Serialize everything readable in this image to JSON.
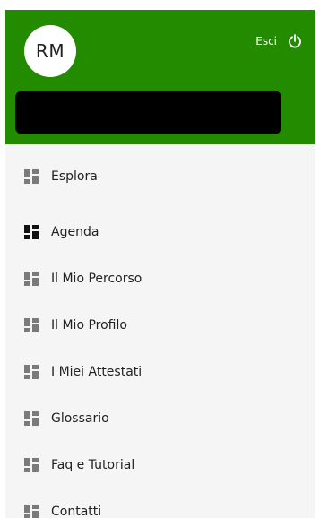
{
  "header": {
    "avatar_initials": "RM",
    "logout_label": "Esci",
    "logout_icon": "power-icon",
    "background_color": "#228b00"
  },
  "menu": {
    "items": [
      {
        "label": "Esplora",
        "icon": "dashboard-icon",
        "active": false
      },
      {
        "label": "Agenda",
        "icon": "dashboard-icon",
        "active": true
      },
      {
        "label": "Il Mio Percorso",
        "icon": "dashboard-icon",
        "active": false
      },
      {
        "label": "Il Mio Profilo",
        "icon": "dashboard-icon",
        "active": false
      },
      {
        "label": "I Miei Attestati",
        "icon": "dashboard-icon",
        "active": false
      },
      {
        "label": "Glossario",
        "icon": "dashboard-icon",
        "active": false
      },
      {
        "label": "Faq e Tutorial",
        "icon": "dashboard-icon",
        "active": false
      },
      {
        "label": "Contatti",
        "icon": "dashboard-icon",
        "active": false
      }
    ],
    "icon_color": "#7a7a7a",
    "active_icon_color": "#111111"
  }
}
